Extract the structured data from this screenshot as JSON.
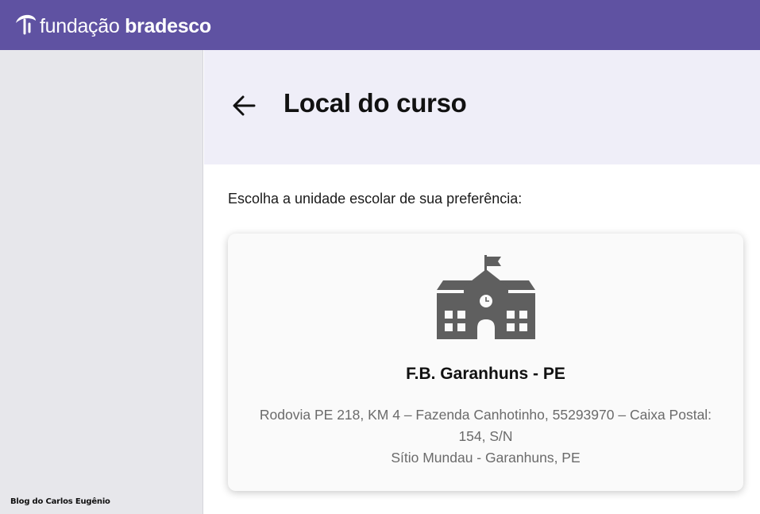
{
  "brand": {
    "name_light": "fundação",
    "name_bold": "bradesco",
    "bar_color": "#5f52a2"
  },
  "header": {
    "back_icon": "arrow-left-icon",
    "title": "Local do curso"
  },
  "main": {
    "instruction": "Escolha a unidade escolar de sua preferência:",
    "units": [
      {
        "icon": "school-building-icon",
        "name": "F.B. Garanhuns - PE",
        "address_line1": "Rodovia PE 218, KM 4 – Fazenda Canhotinho, 55293970 – Caixa Postal:",
        "address_line2": "154, S/N",
        "address_line3": "Sítio Mundau - Garanhuns, PE"
      }
    ]
  },
  "watermark": "Blog do Carlos Eugênio"
}
